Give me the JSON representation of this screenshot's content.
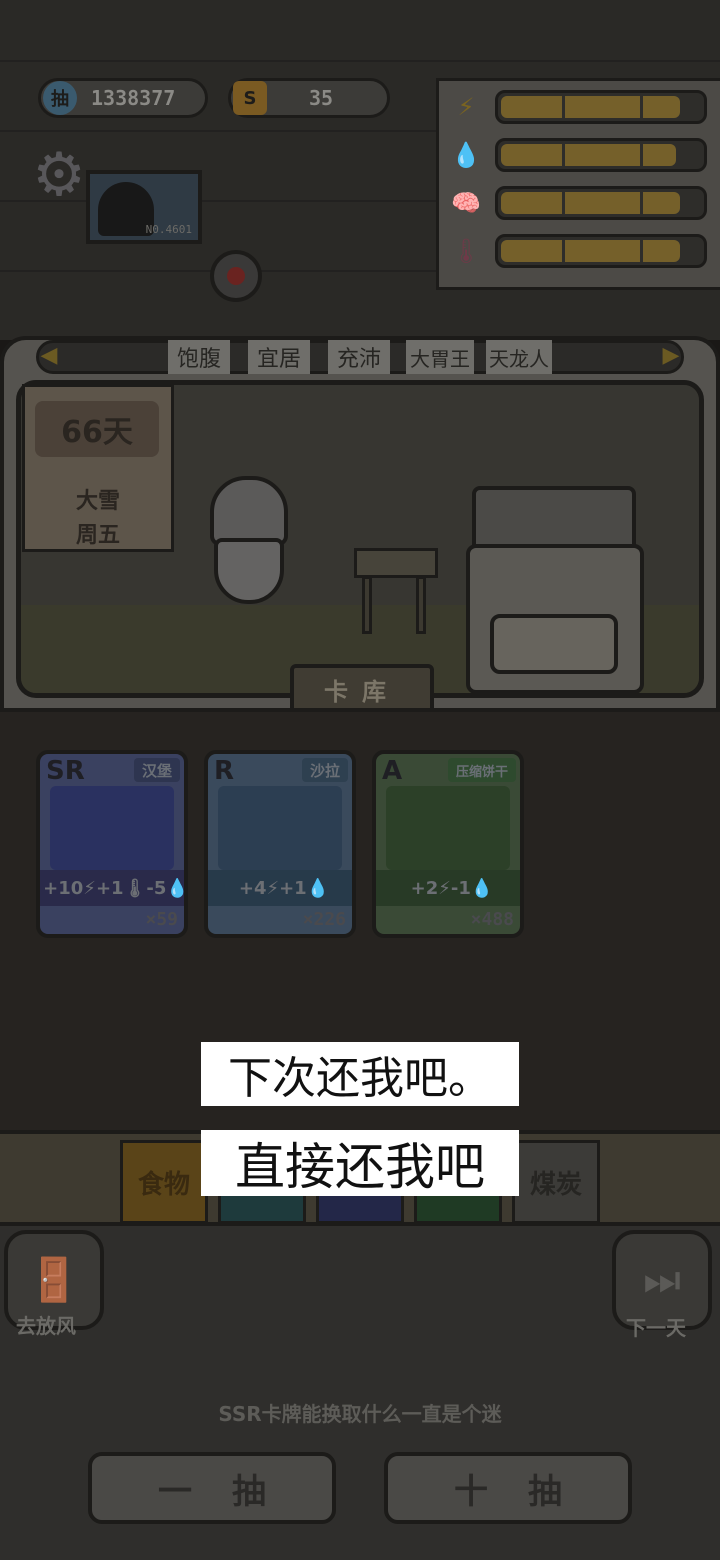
{
  "resources": {
    "draw_tickets": "1338377",
    "ticket_badge": "抽",
    "currency": "35",
    "currency_badge": "S"
  },
  "stats": {
    "icons": [
      "lightning-icon",
      "water-drop-icon",
      "brain-icon",
      "thermometer-icon"
    ],
    "levels": [
      0.9,
      0.88,
      0.9,
      0.9
    ]
  },
  "monitor": {
    "label": "N0.4601"
  },
  "tabs": [
    "饱腹",
    "宜居",
    "充沛",
    "大胃王",
    "天龙人"
  ],
  "calendar": {
    "day": "66天",
    "weather": "大雪",
    "weekday": "周五"
  },
  "card_library_label": "卡库",
  "cards": [
    {
      "rarity": "SR",
      "name": "汉堡",
      "effects": "+10⚡+1🌡-5💧",
      "count": "×59"
    },
    {
      "rarity": "R",
      "name": "沙拉",
      "effects": "+4⚡+1💧",
      "count": "×226"
    },
    {
      "rarity": "A",
      "name": "压缩饼干",
      "effects": "+2⚡-1💧",
      "count": "×488"
    }
  ],
  "categories": [
    "食物",
    "",
    "",
    "",
    "煤炭"
  ],
  "buttons": {
    "go_out": "去放风",
    "next_day": "下一天",
    "draw_one": "一抽",
    "draw_ten": "十抽"
  },
  "tip": "SSR卡牌能换取什么一直是个迷",
  "dialogue_options": [
    "下次还我吧。",
    "直接还我吧"
  ],
  "colors": {
    "overlay_dim": "#000000",
    "option_bg": "#ffffff",
    "bar_fill": "#75602a"
  }
}
